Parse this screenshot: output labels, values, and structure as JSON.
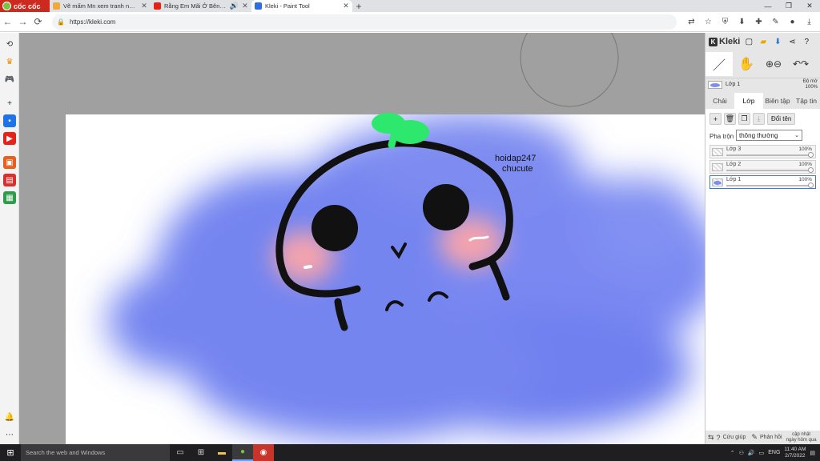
{
  "browser": {
    "brand": "cốc cốc",
    "tabs": [
      {
        "title": "Vẽ mấm Mn xem tranh này c",
        "icon": "hoidap-favicon",
        "color": "#f0a93a",
        "active": false
      },
      {
        "title": "Rằng Em Mãi Ở Bên (Bích",
        "icon": "youtube-favicon",
        "color": "#e62117",
        "active": false
      },
      {
        "title": "Kleki - Paint Tool",
        "icon": "kleki-favicon",
        "color": "#2d6fe0",
        "active": true
      }
    ],
    "url": "https://kleki.com"
  },
  "canvas": {
    "text_line1": "hoidap247",
    "text_line2": "chucute",
    "colors": {
      "blob": "#7585f0",
      "sprout": "#2ee86e",
      "blush": "#f4a3ad",
      "ink": "#111111"
    }
  },
  "panel": {
    "app_name": "Kleki",
    "current_layer": "Lớp 1",
    "opacity_label": "Độ mờ",
    "opacity_value": "100%",
    "tabs": [
      "Chải",
      "Lớp",
      "Biên tập",
      "Tập tin"
    ],
    "active_tab": "Lớp",
    "rename": "Đổi tên",
    "blend_label": "Pha trộn",
    "blend_value": "thông thường",
    "layers": [
      {
        "name": "Lớp 3",
        "opacity": "100%",
        "selected": false,
        "filled": false
      },
      {
        "name": "Lớp 2",
        "opacity": "100%",
        "selected": false,
        "filled": false
      },
      {
        "name": "Lớp 1",
        "opacity": "100%",
        "selected": true,
        "filled": true
      }
    ],
    "footer": {
      "help": "Cứu giúp",
      "feedback": "Phản hồi",
      "update_line1": "cập nhật",
      "update_line2": "ngày hôm qua"
    }
  },
  "taskbar": {
    "search_placeholder": "Search the web and Windows",
    "lang": "ENG",
    "time": "11:40 AM",
    "date": "2/7/2022"
  }
}
